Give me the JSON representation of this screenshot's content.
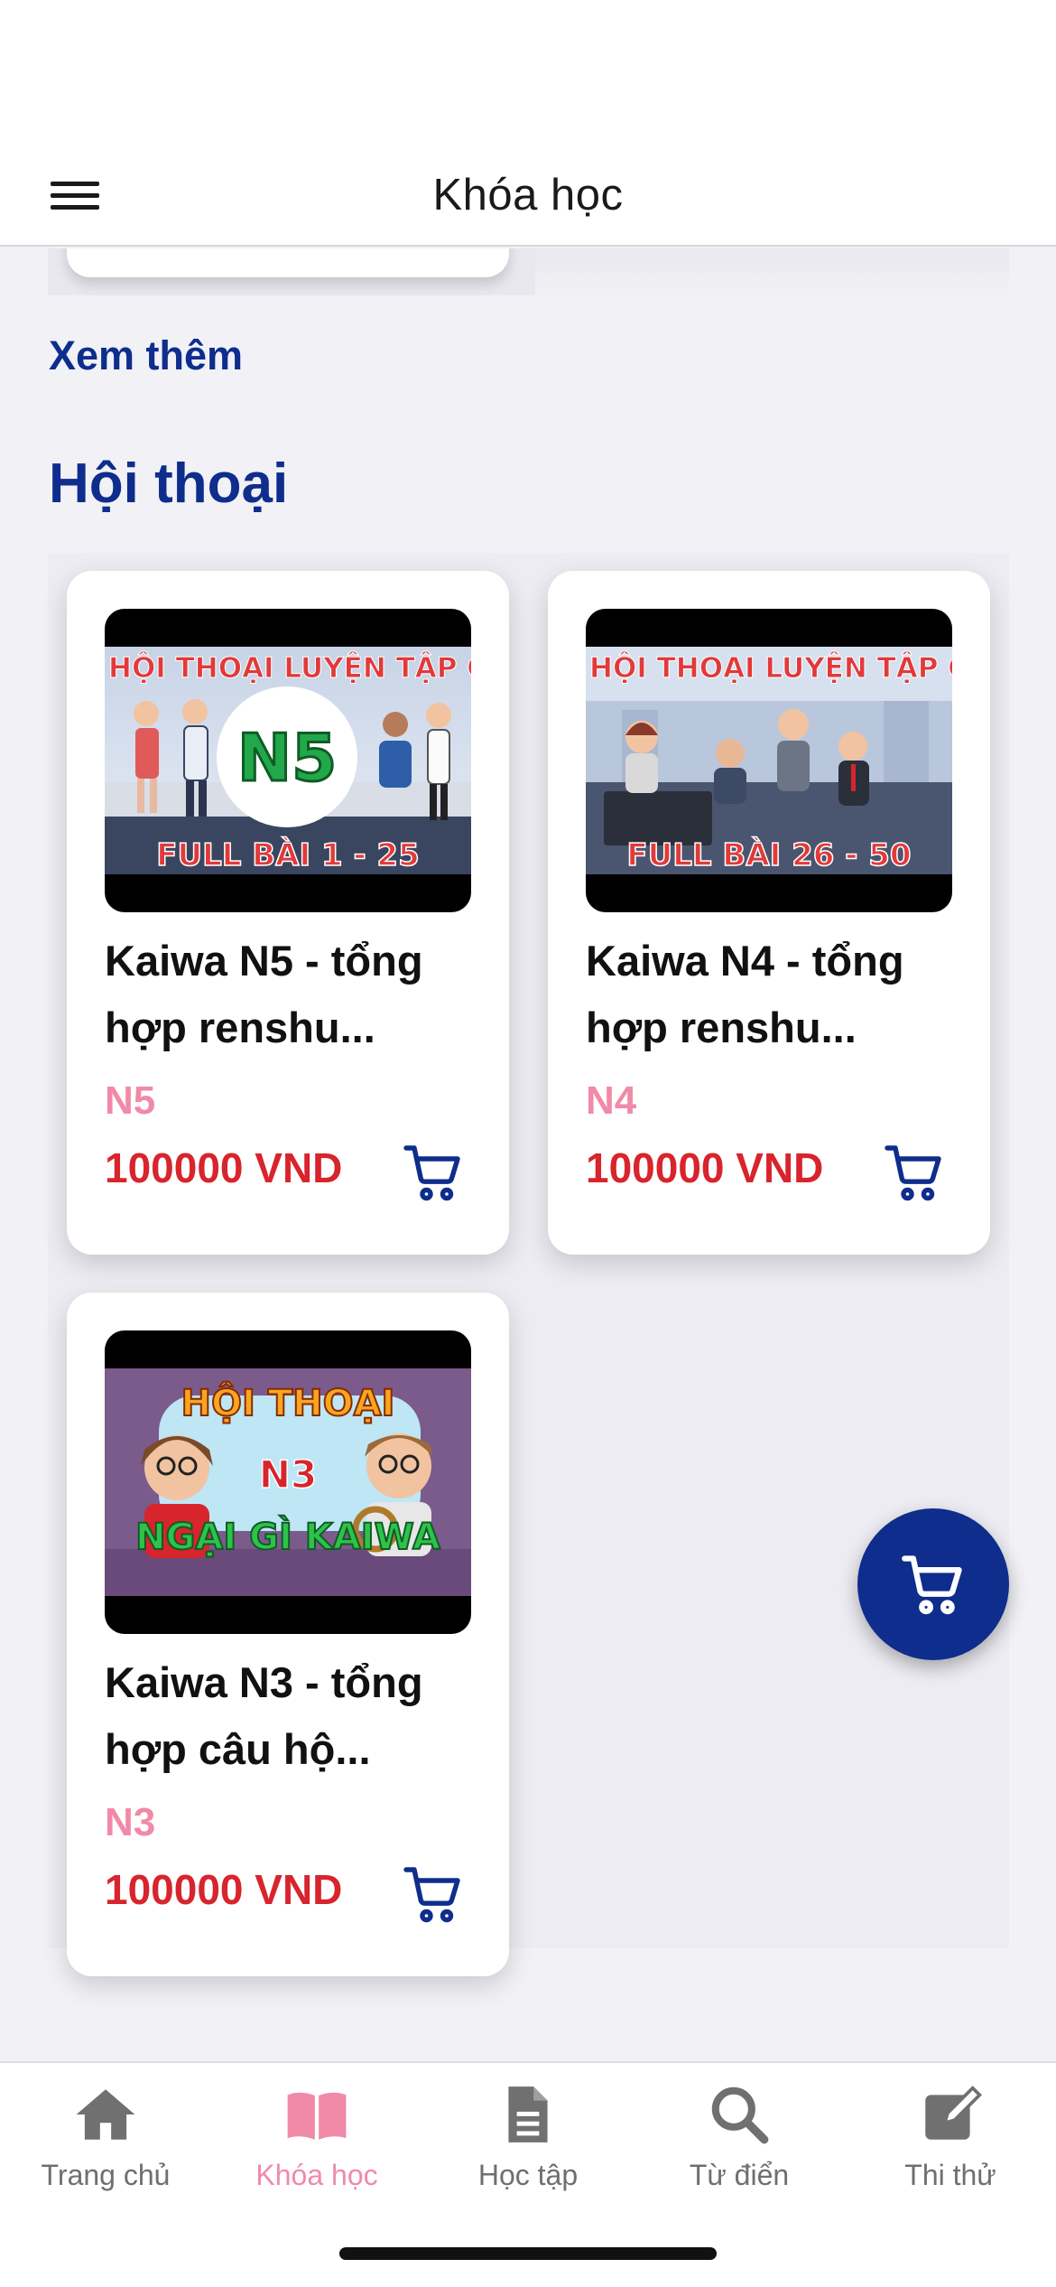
{
  "header": {
    "title": "Khóa học"
  },
  "see_more_label": "Xem thêm",
  "section": {
    "title": "Hội thoại"
  },
  "courses": [
    {
      "title_line1": "Kaiwa N5 - tổng",
      "title_line2": "hợp renshu...",
      "level": "N5",
      "price": "100000 VND",
      "thumb": {
        "banner": "HỘI THOẠI LUYỆN TẬP C",
        "badge": "N5",
        "footer": "FULL BÀI 1 - 25"
      }
    },
    {
      "title_line1": "Kaiwa N4 - tổng",
      "title_line2": "hợp renshu...",
      "level": "N4",
      "price": "100000 VND",
      "thumb": {
        "banner": "HỘI THOẠI LUYỆN TẬP C",
        "footer": "FULL BÀI 26 - 50"
      }
    },
    {
      "title_line1": "Kaiwa N3 - tổng",
      "title_line2": "hợp câu hộ...",
      "level": "N3",
      "price": "100000 VND",
      "thumb": {
        "banner": "HỘI THOẠI",
        "badge": "N3",
        "footer": "NGẠI GÌ KAIWA"
      }
    }
  ],
  "tabs": [
    {
      "label": "Trang chủ",
      "icon": "home-icon"
    },
    {
      "label": "Khóa học",
      "icon": "book-icon",
      "active": true
    },
    {
      "label": "Học tập",
      "icon": "document-icon"
    },
    {
      "label": "Từ điển",
      "icon": "search-icon"
    },
    {
      "label": "Thi thử",
      "icon": "edit-icon"
    }
  ],
  "colors": {
    "primary": "#0e2d8c",
    "price": "#d8242c",
    "level": "#f08aa8",
    "active_tab": "#f08aa8",
    "inactive_tab": "#6f6f6f"
  }
}
